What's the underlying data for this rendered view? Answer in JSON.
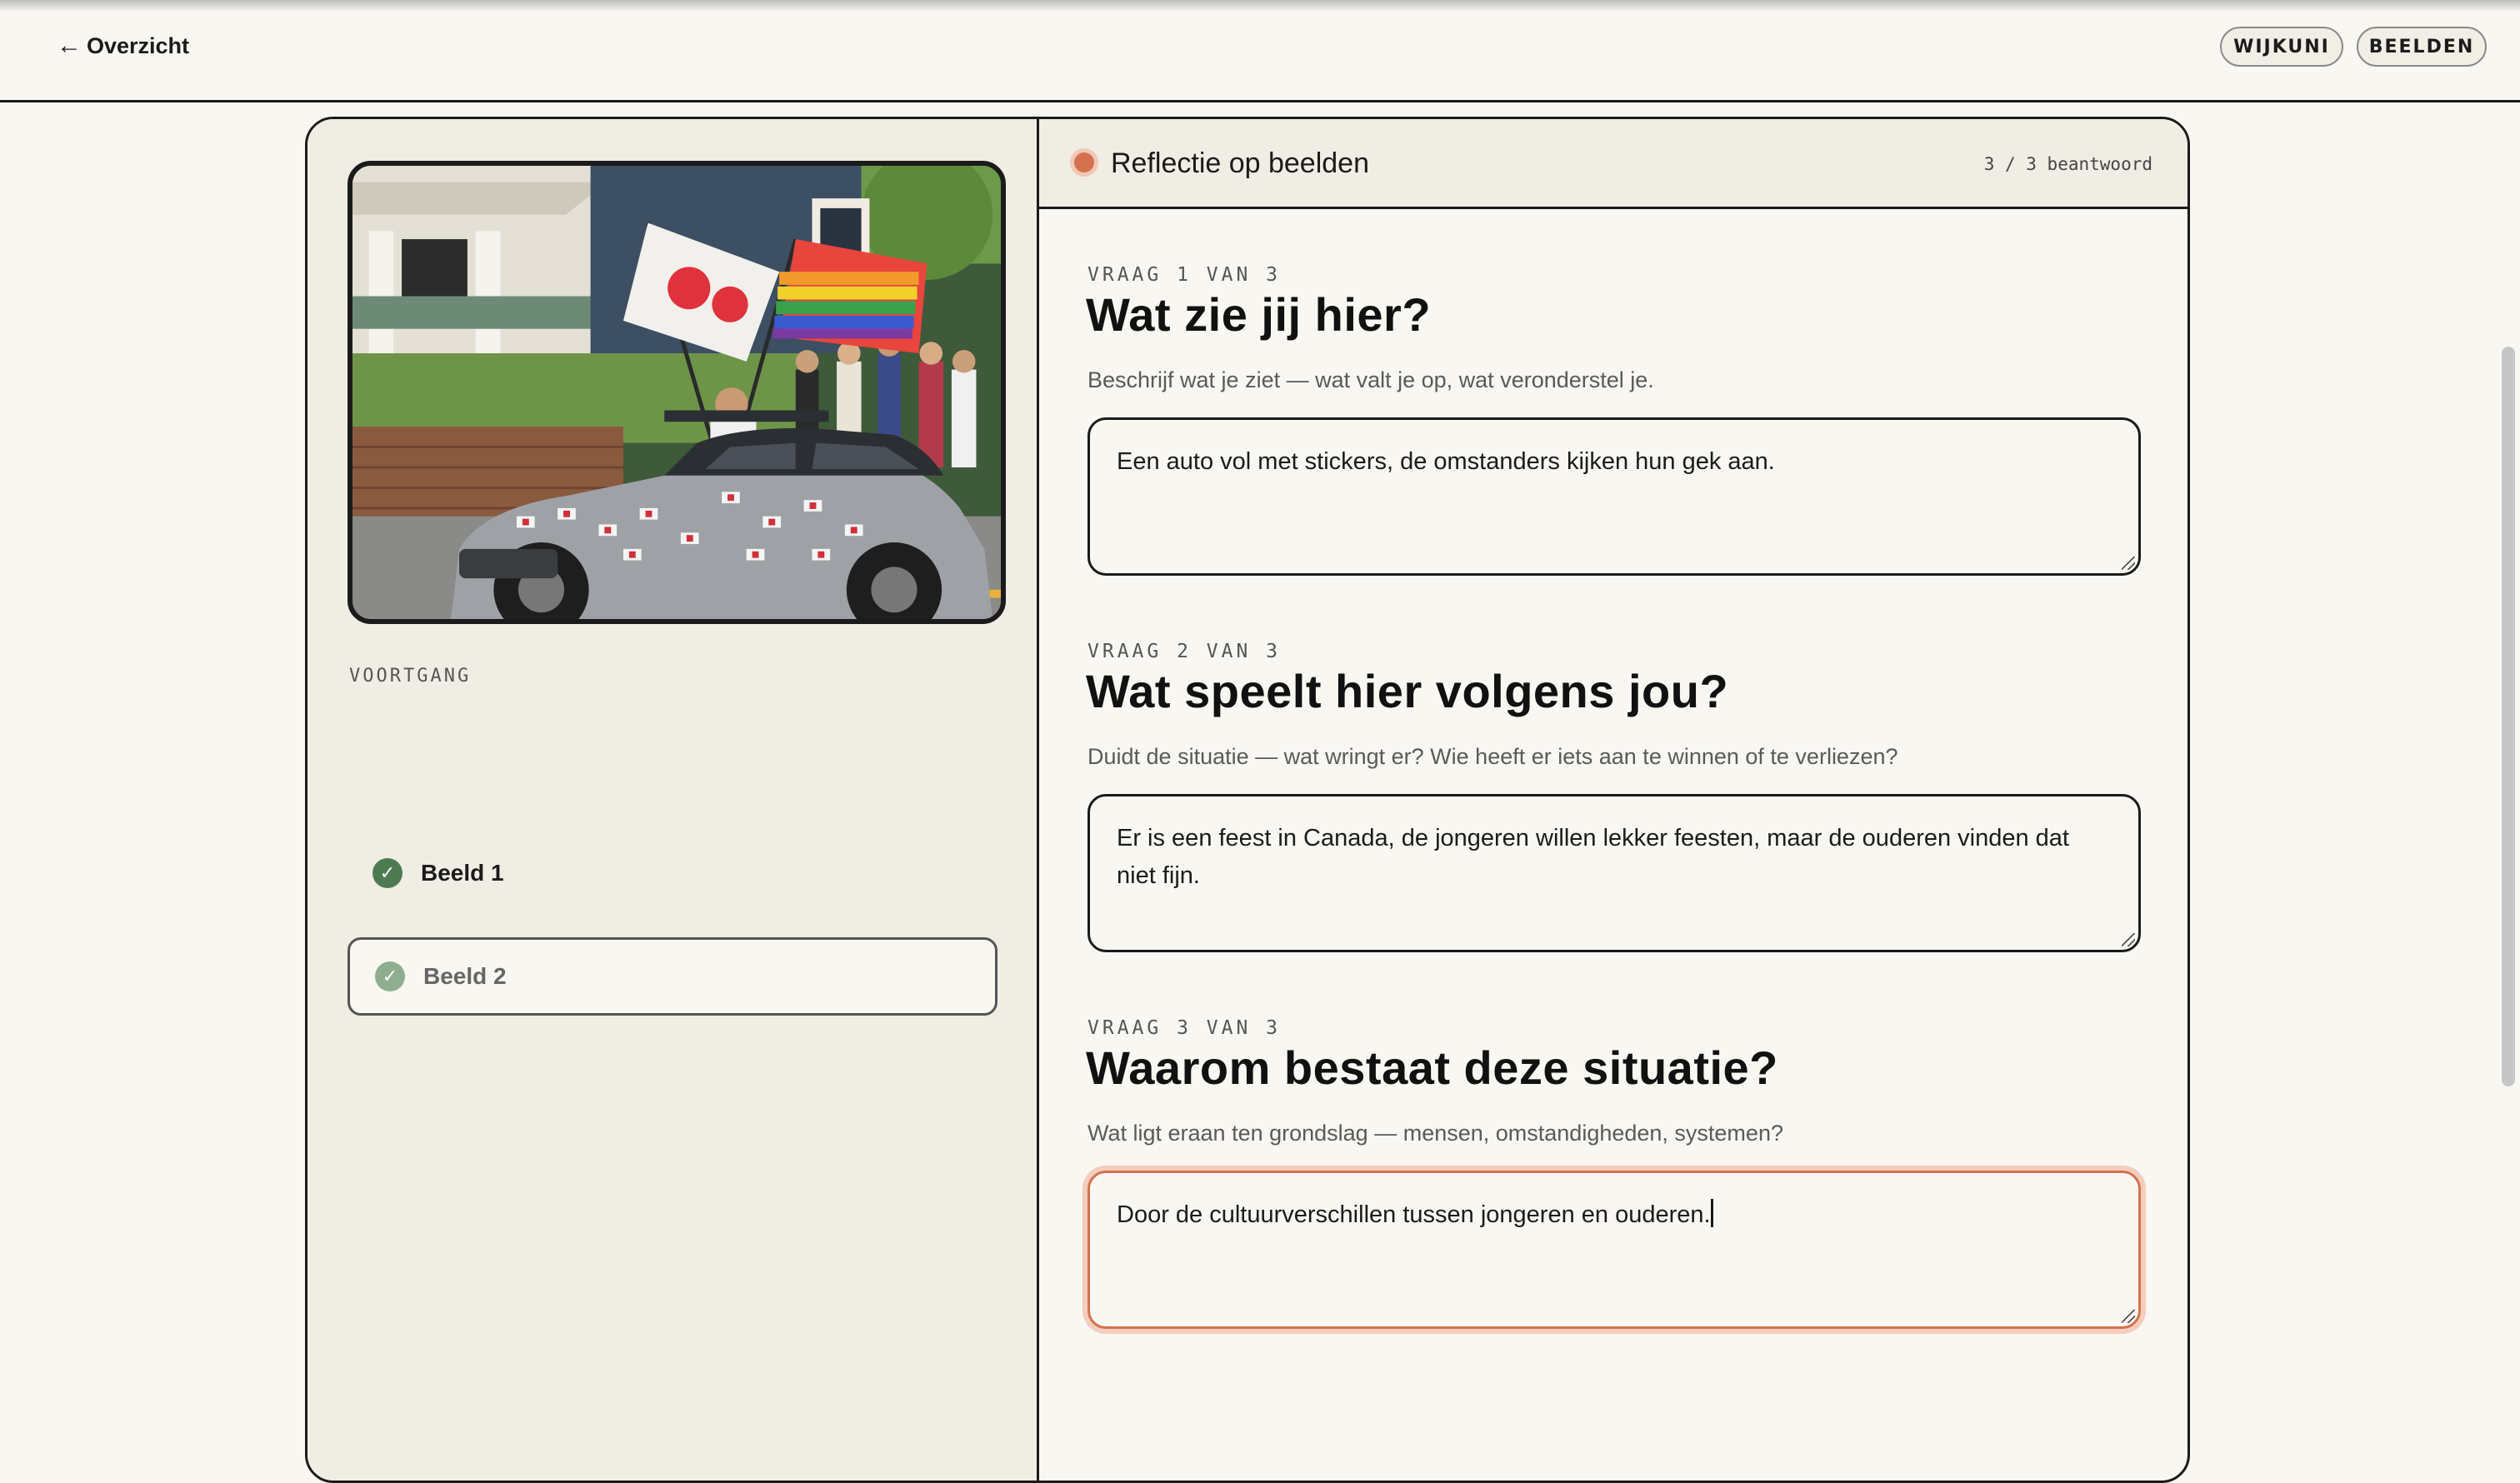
{
  "topbar": {
    "back_label": "Overzicht",
    "pills": [
      "WIJKUNI",
      "BEELDEN"
    ]
  },
  "sidebar": {
    "progress_label": "VOORTGANG",
    "items": [
      {
        "label": "Beeld 1",
        "status": "done"
      },
      {
        "label": "Beeld 2",
        "status": "active"
      }
    ]
  },
  "panel": {
    "title": "Reflectie op beelden",
    "count": "3 / 3 beantwoord",
    "questions": [
      {
        "kicker": "VRAAG 1 VAN 3",
        "title": "Wat zie jij hier?",
        "help": "Beschrijf wat je ziet — wat valt je op, wat veronderstel je.",
        "answer": "Een auto vol met stickers, de omstanders kijken hun gek aan."
      },
      {
        "kicker": "VRAAG 2 VAN 3",
        "title": "Wat speelt hier volgens jou?",
        "help": "Duidt de situatie — wat wringt er? Wie heeft er iets aan te winnen of te verliezen?",
        "answer": "Er is een feest in Canada, de jongeren willen lekker feesten, maar de ouderen vinden dat niet fijn."
      },
      {
        "kicker": "VRAAG 3 VAN 3",
        "title": "Waarom bestaat deze situatie?",
        "help": "Wat ligt eraan ten grondslag — mensen, omstandigheden, systemen?",
        "answer": "Door de cultuurverschillen tussen jongeren en ouderen."
      }
    ]
  },
  "colors": {
    "accent": "#d4724f",
    "done": "#4e7a52",
    "ink": "#1b1b1b",
    "paper": "#f9f7f2",
    "panel": "#f0ede4"
  },
  "icons": {
    "back": "arrow-left-icon",
    "check": "check-icon",
    "status": "status-dot-icon"
  }
}
